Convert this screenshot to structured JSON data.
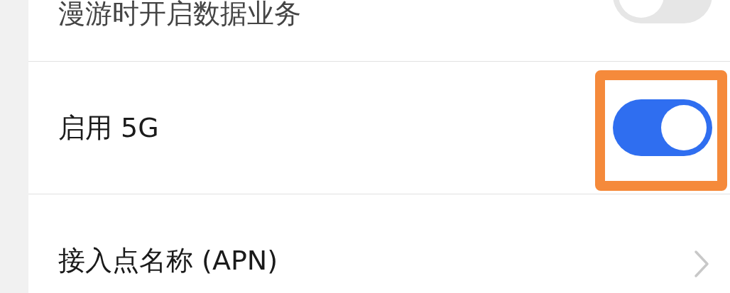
{
  "settings": [
    {
      "kind": "toggle",
      "label": "漫游时开启数据业务",
      "on": false,
      "highlighted": false
    },
    {
      "kind": "toggle",
      "label": "启用 5G",
      "on": true,
      "highlighted": true
    },
    {
      "kind": "link",
      "label": "接入点名称 (APN)",
      "highlighted": false
    }
  ]
}
